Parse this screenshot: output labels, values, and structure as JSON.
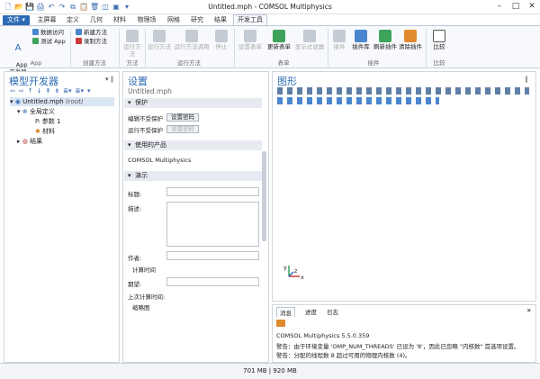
{
  "window": {
    "title": "Untitled.mph - COMSOL Multiphysics",
    "minimize": "–",
    "maximize": "□",
    "close": "✕"
  },
  "quick_access": [
    "🗋",
    "📂",
    "💾",
    "🖨",
    "↶",
    "↷",
    "⧉",
    "📋",
    "🗑",
    "◫",
    "▣",
    "▾"
  ],
  "tabs": [
    "文件 ▾",
    "主屏幕",
    "定义",
    "几何",
    "材料",
    "物理场",
    "网格",
    "研究",
    "结果",
    "开发工具"
  ],
  "ribbon": {
    "app_developer": "App\n开发器",
    "data_access": "数据访问",
    "test_app": "测试 App",
    "new_method": "新建方法",
    "record_method": "录制方法",
    "group_app": "App",
    "group_create_method": "创建方法",
    "run_method": "运行方法",
    "run_method_call": "运行方法调用",
    "group_method": "方法",
    "run_app": "运行方法",
    "run_method_call2": "运行方法调用",
    "stop": "停止",
    "group_run_method": "运行方法",
    "set_form": "设置表单",
    "update_form": "更新表单",
    "show_form": "显示过滤器",
    "group_form": "表单",
    "plugin": "插件",
    "plugin_lib": "插件库",
    "refresh_plugin": "刷新插件",
    "clear_plugin": "清除插件",
    "group_plugin": "插件",
    "compare": "比较",
    "group_compare": "比较"
  },
  "model_builder": {
    "title": "模型开发器",
    "pin": "▾ ‖",
    "toolbar": [
      "⇦",
      "⇨",
      "↑",
      "↓",
      "⇞",
      "⇟",
      "≣▾",
      "≣▾",
      "▾"
    ],
    "root": "Untitled.mph",
    "root_note": "(root)",
    "global_defs": "全局定义",
    "params": "参数 1",
    "materials": "材料",
    "results": "结果"
  },
  "settings": {
    "title": "设置",
    "subtitle": "Untitled.mph",
    "sec_protect": "保护",
    "edit_protect_label": "编辑不受保护",
    "set_password": "设置密码",
    "run_protect_label": "运行不受保护",
    "set_password2": "设置密码",
    "sec_products": "使用的产品",
    "product": "COMSOL Multiphysics",
    "sec_demo": "演示",
    "title_label": "标题:",
    "desc_label": "描述:",
    "author_label": "作者:",
    "calc_time": "计算时间",
    "expected_label": "期望:",
    "last_calc_label": "上次计算时间:",
    "thumbnail": "缩略图"
  },
  "graphics": {
    "title": "图形",
    "pin": "‖"
  },
  "axes": {
    "x": "x",
    "y": "y",
    "z": "z"
  },
  "messages": {
    "tabs": [
      "消息",
      "进度",
      "日志"
    ],
    "close": "✕",
    "lines": [
      "COMSOL Multiphysics 5.5.0.359",
      "警告：由于环境变量 'OMP_NUM_THREADS' 已设为 '8'，因此已忽略 \"内核数\" 首选项设置。",
      "警告：分配的线程数 8 超过可用的物理内核数 (4)。"
    ]
  },
  "status": "701 MB | 920 MB"
}
